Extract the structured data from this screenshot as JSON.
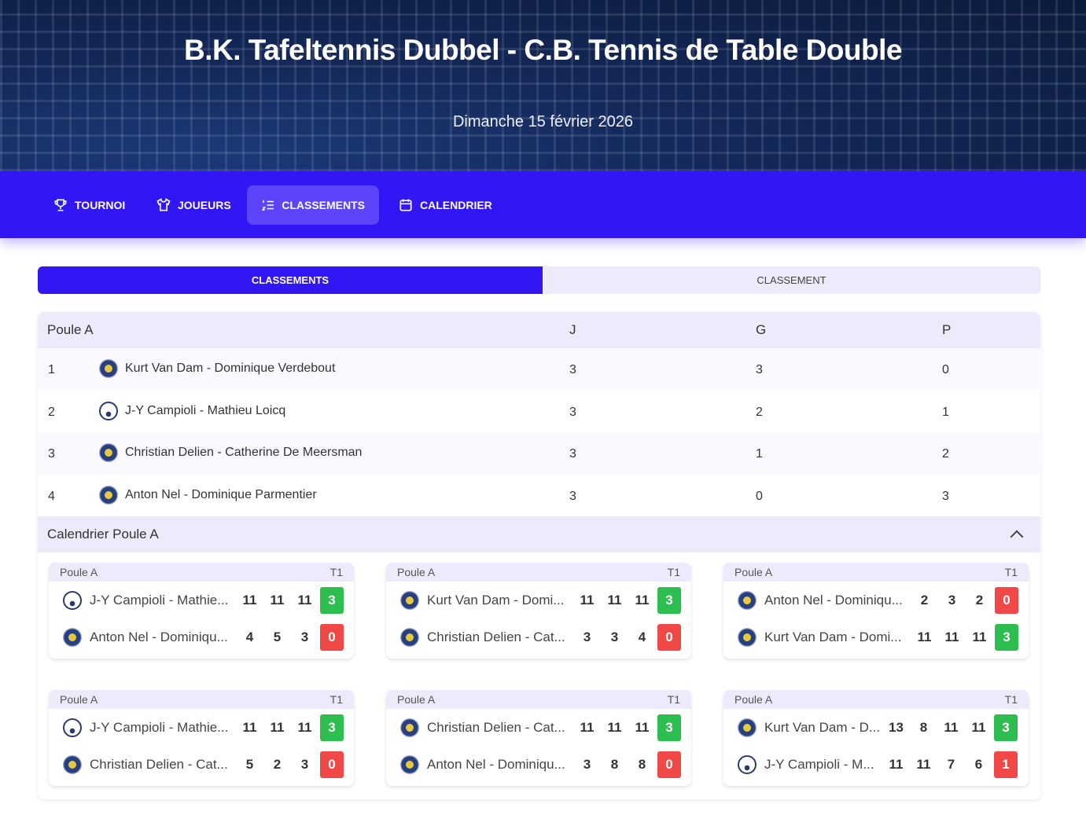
{
  "header": {
    "title": "B.K. Tafeltennis Dubbel - C.B. Tennis de Table Double",
    "date": "Dimanche 15 février 2026"
  },
  "nav": [
    {
      "label": "TOURNOI",
      "icon": "trophy-icon"
    },
    {
      "label": "JOUEURS",
      "icon": "shirt-icon"
    },
    {
      "label": "CLASSEMENTS",
      "icon": "ordered-list-icon",
      "active": true
    },
    {
      "label": "CALENDRIER",
      "icon": "calendar-icon"
    }
  ],
  "tabs": [
    "CLASSEMENTS",
    "CLASSEMENT"
  ],
  "standings": {
    "title": "Poule A",
    "cols": [
      "J",
      "G",
      "P"
    ],
    "rows": [
      {
        "rank": "1",
        "team": "Kurt Van Dam - Dominique Verdebout",
        "logo": "rlsd",
        "j": "3",
        "g": "3",
        "p": "0"
      },
      {
        "rank": "2",
        "team": "J-Y Campioli - Mathieu Loicq",
        "logo": "camp",
        "j": "3",
        "g": "2",
        "p": "1"
      },
      {
        "rank": "3",
        "team": "Christian Delien - Catherine De Meersman",
        "logo": "rlsd",
        "j": "3",
        "g": "1",
        "p": "2"
      },
      {
        "rank": "4",
        "team": "Anton Nel - Dominique Parmentier",
        "logo": "rlsd",
        "j": "3",
        "g": "0",
        "p": "3"
      }
    ]
  },
  "calendar": {
    "title": "Calendrier Poule A",
    "matches": [
      {
        "pool": "Poule A",
        "table": "T1",
        "teams": [
          {
            "name": "J-Y Campioli - Mathie...",
            "logo": "camp",
            "scores": [
              "11",
              "11",
              "11"
            ],
            "result": "3",
            "win": true
          },
          {
            "name": "Anton Nel - Dominiqu...",
            "logo": "rlsd",
            "scores": [
              "4",
              "5",
              "3"
            ],
            "result": "0",
            "win": false
          }
        ]
      },
      {
        "pool": "Poule A",
        "table": "T1",
        "teams": [
          {
            "name": "Kurt Van Dam - Domi...",
            "logo": "rlsd",
            "scores": [
              "11",
              "11",
              "11"
            ],
            "result": "3",
            "win": true
          },
          {
            "name": "Christian Delien - Cat...",
            "logo": "rlsd",
            "scores": [
              "3",
              "3",
              "4"
            ],
            "result": "0",
            "win": false
          }
        ]
      },
      {
        "pool": "Poule A",
        "table": "T1",
        "teams": [
          {
            "name": "Anton Nel - Dominiqu...",
            "logo": "rlsd",
            "scores": [
              "2",
              "3",
              "2"
            ],
            "result": "0",
            "win": false
          },
          {
            "name": "Kurt Van Dam - Domi...",
            "logo": "rlsd",
            "scores": [
              "11",
              "11",
              "11"
            ],
            "result": "3",
            "win": true
          }
        ]
      },
      {
        "pool": "Poule A",
        "table": "T1",
        "teams": [
          {
            "name": "J-Y Campioli - Mathie...",
            "logo": "camp",
            "scores": [
              "11",
              "11",
              "11"
            ],
            "result": "3",
            "win": true
          },
          {
            "name": "Christian Delien - Cat...",
            "logo": "rlsd",
            "scores": [
              "5",
              "2",
              "3"
            ],
            "result": "0",
            "win": false
          }
        ]
      },
      {
        "pool": "Poule A",
        "table": "T1",
        "teams": [
          {
            "name": "Christian Delien - Cat...",
            "logo": "rlsd",
            "scores": [
              "11",
              "11",
              "11"
            ],
            "result": "3",
            "win": true
          },
          {
            "name": "Anton Nel - Dominiqu...",
            "logo": "rlsd",
            "scores": [
              "3",
              "8",
              "8"
            ],
            "result": "0",
            "win": false
          }
        ]
      },
      {
        "pool": "Poule A",
        "table": "T1",
        "teams": [
          {
            "name": "Kurt Van Dam - D...",
            "logo": "rlsd",
            "scores": [
              "13",
              "8",
              "11",
              "11"
            ],
            "result": "3",
            "win": true
          },
          {
            "name": "J-Y Campioli - M...",
            "logo": "camp",
            "scores": [
              "11",
              "11",
              "7",
              "6"
            ],
            "result": "1",
            "win": false
          }
        ]
      }
    ]
  }
}
